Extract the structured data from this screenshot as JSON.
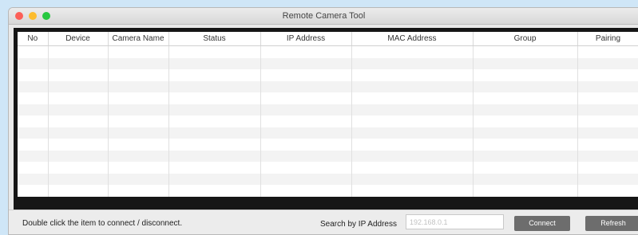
{
  "window": {
    "title": "Remote Camera Tool"
  },
  "table": {
    "columns": [
      "No",
      "Device",
      "Camera Name",
      "Status",
      "IP Address",
      "MAC Address",
      "Group",
      "Pairing"
    ],
    "rows": []
  },
  "footer": {
    "hint": "Double click the item to connect / disconnect.",
    "search_label": "Search by IP Address",
    "search_placeholder": "192.168.0.1",
    "connect_label": "Connect",
    "refresh_label": "Refresh"
  }
}
